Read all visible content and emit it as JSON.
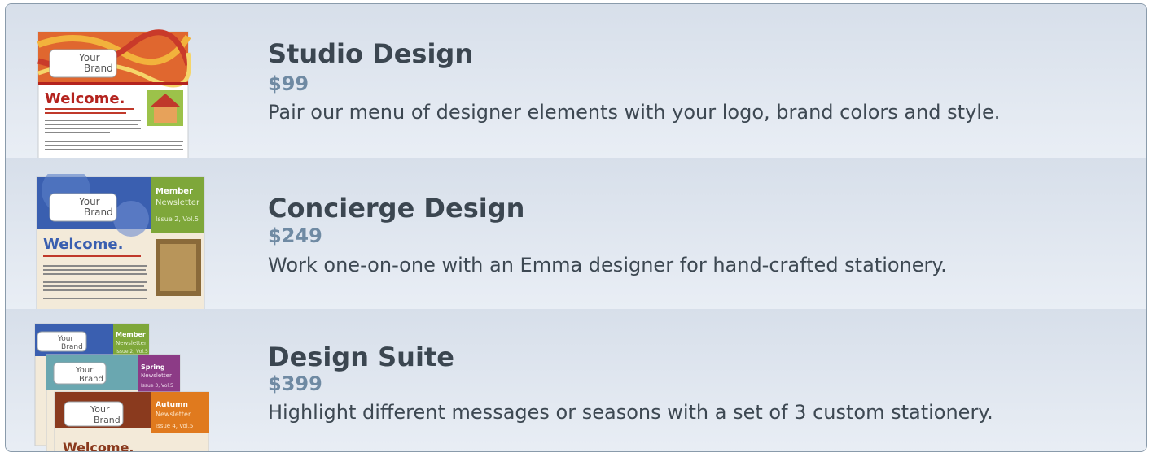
{
  "products": [
    {
      "title": "Studio Design",
      "price": "$99",
      "description": "Pair our menu of designer elements with your logo, brand colors and style."
    },
    {
      "title": "Concierge Design",
      "price": "$249",
      "description": "Work one-on-one with an Emma designer for hand-crafted stationery."
    },
    {
      "title": "Design Suite",
      "price": "$399",
      "description": "Highlight different messages or seasons with a set of 3 custom stationery."
    }
  ],
  "thumbnails": {
    "brand_line1": "Your",
    "brand_line2": "Brand",
    "welcome": "Welcome.",
    "member_title": "Member",
    "member_sub": "Newsletter",
    "member_issue": "Issue 2, Vol.5",
    "spring_title": "Spring",
    "spring_sub": "Newsletter",
    "spring_issue": "Issue 3, Vol.5",
    "autumn_title": "Autumn",
    "autumn_sub": "Newsletter",
    "autumn_issue": "Issue 4, Vol.5"
  },
  "colors": {
    "studio_red": "#b4231e",
    "concierge_blue": "#3a5fb0",
    "member_green": "#7ea73a",
    "spring_purple": "#8c3b86",
    "spring_teal": "#6aa7b0",
    "autumn_brown": "#8a3a1e",
    "autumn_orange": "#e07a1e"
  }
}
